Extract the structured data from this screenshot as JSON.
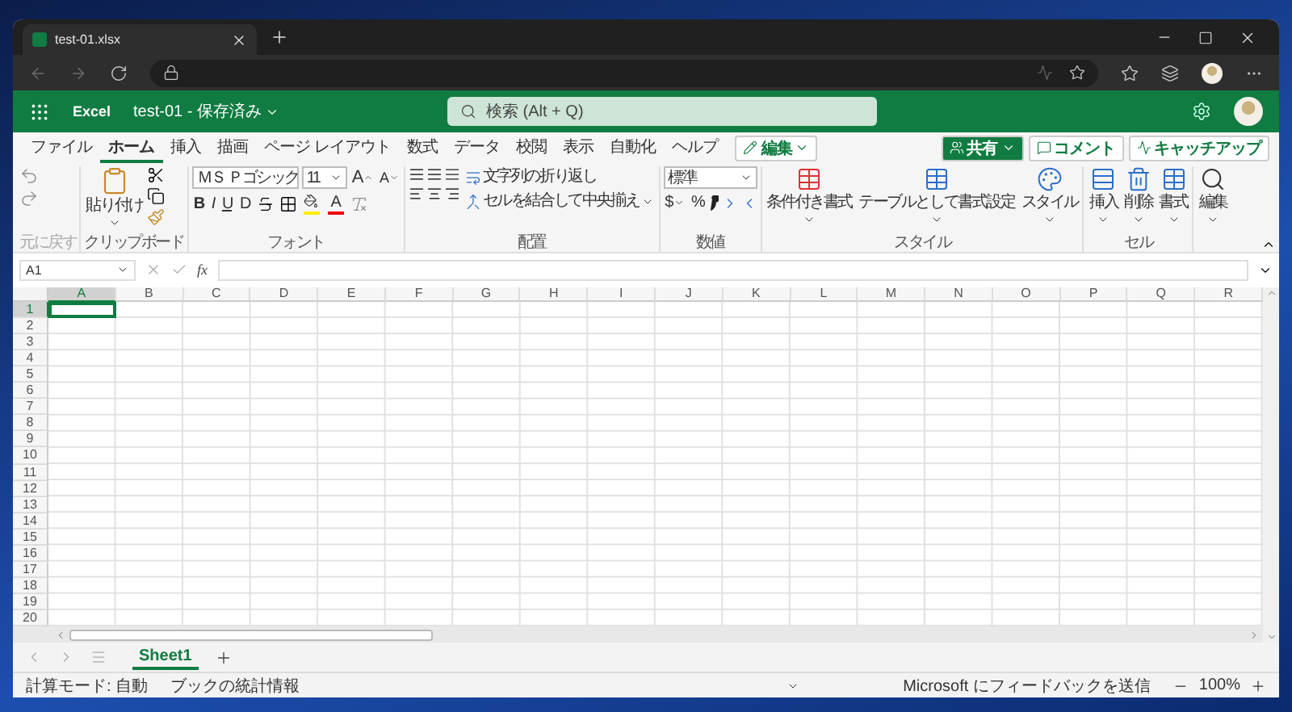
{
  "browser": {
    "tab_title": "test-01.xlsx"
  },
  "app": {
    "name": "Excel",
    "document": "test-01 - 保存済み",
    "search_placeholder": "検索 (Alt + Q)"
  },
  "ribbon_tabs": [
    {
      "label": "ファイル",
      "selected": false
    },
    {
      "label": "ホーム",
      "selected": true
    },
    {
      "label": "挿入",
      "selected": false
    },
    {
      "label": "描画",
      "selected": false
    },
    {
      "label": "ページ レイアウト",
      "selected": false
    },
    {
      "label": "数式",
      "selected": false
    },
    {
      "label": "データ",
      "selected": false
    },
    {
      "label": "校閲",
      "selected": false
    },
    {
      "label": "表示",
      "selected": false
    },
    {
      "label": "自動化",
      "selected": false
    },
    {
      "label": "ヘルプ",
      "selected": false
    }
  ],
  "header_buttons": {
    "mode": "編集",
    "share": "共有",
    "comment": "コメント",
    "catchup": "キャッチアップ"
  },
  "ribbon": {
    "undo": {
      "label": "元に戻す",
      "disabled": true
    },
    "clipboard": {
      "paste": "貼り付け",
      "label": "クリップボード"
    },
    "font": {
      "name": "ＭＳ Ｐゴシック",
      "size": "11",
      "grow": "A",
      "shrink": "A",
      "styles": [
        "B",
        "I",
        "U",
        "D"
      ],
      "font_color": "A",
      "label": "フォント"
    },
    "alignment": {
      "wrap": "文字列の折り返し",
      "merge": "セルを結合して中央揃え",
      "label": "配置"
    },
    "number": {
      "format": "標準",
      "currency": "$",
      "percent": "%",
      "label": "数値"
    },
    "styles": {
      "items": [
        "条件付き書式",
        "テーブルとして書式設定",
        "スタイル"
      ],
      "label": "スタイル"
    },
    "cells": {
      "items": [
        "挿入",
        "削除",
        "書式"
      ],
      "label": "セル"
    },
    "editing": {
      "find": "編集"
    }
  },
  "formula_bar": {
    "name_box": "A1",
    "fx": "fx"
  },
  "sheet": {
    "columns": [
      {
        "label": "A",
        "selected": true
      },
      {
        "label": "B",
        "selected": false
      },
      {
        "label": "C",
        "selected": false
      },
      {
        "label": "D",
        "selected": false
      },
      {
        "label": "E",
        "selected": false
      },
      {
        "label": "F",
        "selected": false
      },
      {
        "label": "G",
        "selected": false
      },
      {
        "label": "H",
        "selected": false
      },
      {
        "label": "I",
        "selected": false
      },
      {
        "label": "J",
        "selected": false
      },
      {
        "label": "K",
        "selected": false
      },
      {
        "label": "L",
        "selected": false
      },
      {
        "label": "M",
        "selected": false
      },
      {
        "label": "N",
        "selected": false
      },
      {
        "label": "O",
        "selected": false
      },
      {
        "label": "P",
        "selected": false
      },
      {
        "label": "Q",
        "selected": false
      },
      {
        "label": "R",
        "selected": false
      }
    ],
    "rows": [
      {
        "label": "1",
        "selected": true
      },
      {
        "label": "2",
        "selected": false
      },
      {
        "label": "3",
        "selected": false
      },
      {
        "label": "4",
        "selected": false
      },
      {
        "label": "5",
        "selected": false
      },
      {
        "label": "6",
        "selected": false
      },
      {
        "label": "7",
        "selected": false
      },
      {
        "label": "8",
        "selected": false
      },
      {
        "label": "9",
        "selected": false
      },
      {
        "label": "10",
        "selected": false
      },
      {
        "label": "11",
        "selected": false
      },
      {
        "label": "12",
        "selected": false
      },
      {
        "label": "13",
        "selected": false
      },
      {
        "label": "14",
        "selected": false
      },
      {
        "label": "15",
        "selected": false
      },
      {
        "label": "16",
        "selected": false
      },
      {
        "label": "17",
        "selected": false
      },
      {
        "label": "18",
        "selected": false
      },
      {
        "label": "19",
        "selected": false
      },
      {
        "label": "20",
        "selected": false
      }
    ]
  },
  "sheet_tabs": [
    {
      "label": "Sheet1",
      "selected": true
    }
  ],
  "status_bar": {
    "calc_mode": "計算モード: 自動",
    "stats": "ブックの統計情報",
    "feedback": "Microsoft にフィードバックを送信",
    "zoom": "100%"
  }
}
